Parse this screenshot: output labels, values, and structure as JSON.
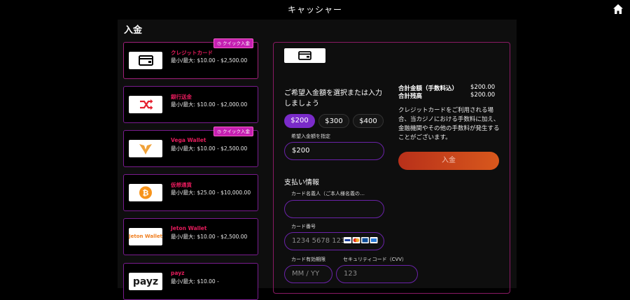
{
  "header": {
    "title": "キャッシャー"
  },
  "page": {
    "heading": "入金"
  },
  "methods": [
    {
      "name": "クレジットカード",
      "limit_label": "最小/最大: $10.00 - $2,500.00",
      "badge": "クイック入金"
    },
    {
      "name": "銀行送金",
      "limit_label": "最小/最大: $10.00 - $2,000.00"
    },
    {
      "name": "Vega Wallet",
      "limit_label": "最小/最大: $10.00 - $2,500.00",
      "badge": "クイック入金"
    },
    {
      "name": "仮想通貨",
      "limit_label": "最小/最大: $25.00 - $10,000.00"
    },
    {
      "name": "Jeton Wallet",
      "limit_label": "最小/最大: $10.00 - $2,500.00",
      "logo_text": "Jeton Wallet"
    },
    {
      "name": "payz",
      "limit_label": "最小/最大: $10.00 -",
      "logo_text": "payz"
    }
  ],
  "form": {
    "prompt": "ご希望入金額を選択または入力しましょう",
    "amount_options": [
      "$200",
      "$300",
      "$400"
    ],
    "custom_amount_label": "希望入金額を指定",
    "custom_amount_value": "$200",
    "payment_info_title": "支払い情報",
    "cardholder_label": "カード名義人（ご本人様名義の…",
    "card_number_label": "カード番号",
    "card_number_placeholder": "1234 5678 123",
    "expiry_label": "カード有効期限",
    "expiry_placeholder": "MM / YY",
    "cvv_label": "セキュリティコード（CVV）",
    "cvv_placeholder": "123"
  },
  "summary": {
    "total_fee_label": "合計金額（手数料込）",
    "total_fee_value": "$200.00",
    "total_label": "合計残高",
    "total_value": "$200.00",
    "note": "クレジットカードをご利用される場合、当カジノにおける手数料に加え、金融機関やその他の手数料が発生することがございます。",
    "submit_label": "入金"
  },
  "colors": {
    "accent_pink": "#e51b5c",
    "purple": "#7a2bc9",
    "submit_orange": "#d8581c"
  }
}
